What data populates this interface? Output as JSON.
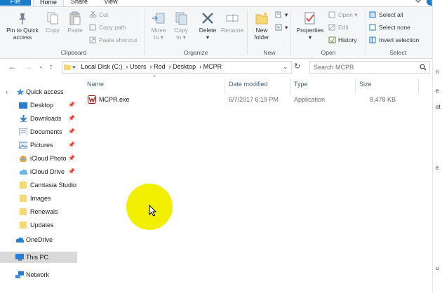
{
  "tabs": {
    "file": "File",
    "home": "Home",
    "share": "Share",
    "view": "View"
  },
  "ribbon": {
    "clipboard": {
      "pin_line1": "Pin to Quick",
      "pin_line2": "access",
      "copy": "Copy",
      "paste": "Paste",
      "cut": "Cut",
      "copy_path": "Copy path",
      "paste_shortcut": "Paste shortcut",
      "label": "Clipboard"
    },
    "organize": {
      "move_line1": "Move",
      "move_line2": "to",
      "copy_line1": "Copy",
      "copy_line2": "to",
      "delete": "Delete",
      "rename": "Rename",
      "label": "Organize"
    },
    "new": {
      "folder_line1": "New",
      "folder_line2": "folder",
      "label": "New"
    },
    "open": {
      "properties": "Properties",
      "open": "Open",
      "edit": "Edit",
      "history": "History",
      "label": "Open"
    },
    "select": {
      "all": "Select all",
      "none": "Select none",
      "invert": "Invert selection",
      "label": "Select"
    }
  },
  "address": {
    "prefix": "«",
    "crumbs": [
      "Local Disk (C:)",
      "Users",
      "Rod",
      "Desktop",
      "MCPR"
    ],
    "search_placeholder": "Search MCPR"
  },
  "nav": {
    "quick_access": "Quick access",
    "items": [
      "Desktop",
      "Downloads",
      "Documents",
      "Pictures",
      "iCloud Photo",
      "iCloud Drive",
      "Camtasia Studio",
      "Images",
      "Renewals",
      "Updates"
    ],
    "onedrive": "OneDrive",
    "thispc": "This PC",
    "network": "Network"
  },
  "columns": {
    "name": "Name",
    "date": "Date modified",
    "type": "Type",
    "size": "Size"
  },
  "files": [
    {
      "name": "MCPR.exe",
      "date": "6/7/2017 6:19 PM",
      "type": "Application",
      "size": "8,478 KB"
    }
  ],
  "colors": {
    "accent": "#1979ca",
    "folder": "#f8d775",
    "highlight": "#f3ef00"
  }
}
